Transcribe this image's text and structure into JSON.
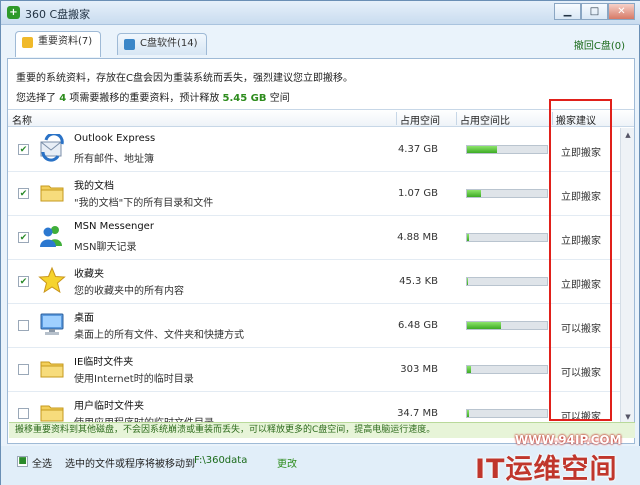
{
  "window": {
    "title": "360 C盘搬家",
    "app_icon": "360-logo-icon"
  },
  "tabs": [
    {
      "label": "重要资料(7)",
      "active": true,
      "icon": "folder-icon"
    },
    {
      "label": "C盘软件(14)",
      "active": false,
      "icon": "software-icon"
    }
  ],
  "restore_link": "撤回C盘(0)",
  "description": {
    "line1": "重要的系统资料，存放在C盘会因为重装系统而丢失，强烈建议您立即搬移。",
    "line2_prefix": "您选择了",
    "selected_count": "4",
    "line2_mid": "项需要搬移的重要资料，预计释放",
    "freed_size": "5.45 GB",
    "line2_suffix": "空间"
  },
  "columns": {
    "name": "名称",
    "size": "占用空间",
    "ratio": "占用空间比",
    "advice": "搬家建议"
  },
  "items": [
    {
      "name": "Outlook Express",
      "desc": "所有邮件、地址簿",
      "size": "4.37 GB",
      "ratio": 0.38,
      "advice": "立即搬家",
      "checked": true,
      "icon": "outlook-express-icon"
    },
    {
      "name": "我的文档",
      "desc": "\"我的文档\"下的所有目录和文件",
      "size": "1.07 GB",
      "ratio": 0.18,
      "advice": "立即搬家",
      "checked": true,
      "icon": "folder-icon"
    },
    {
      "name": "MSN Messenger",
      "desc": "MSN聊天记录",
      "size": "4.88 MB",
      "ratio": 0.02,
      "advice": "立即搬家",
      "checked": true,
      "icon": "msn-messenger-icon"
    },
    {
      "name": "收藏夹",
      "desc": "您的收藏夹中的所有内容",
      "size": "45.3 KB",
      "ratio": 0.01,
      "advice": "立即搬家",
      "checked": true,
      "icon": "star-icon"
    },
    {
      "name": "桌面",
      "desc": "桌面上的所有文件、文件夹和快捷方式",
      "size": "6.48 GB",
      "ratio": 0.43,
      "advice": "可以搬家",
      "checked": false,
      "icon": "desktop-computer-icon"
    },
    {
      "name": "IE临时文件夹",
      "desc": "使用Internet时的临时目录",
      "size": "303 MB",
      "ratio": 0.05,
      "advice": "可以搬家",
      "checked": false,
      "icon": "folder-icon"
    },
    {
      "name": "用户临时文件夹",
      "desc": "使用应用程序时的临时文件目录",
      "size": "34.7 MB",
      "ratio": 0.02,
      "advice": "可以搬家",
      "checked": false,
      "icon": "folder-icon"
    }
  ],
  "notice": "搬移重要资料到其他磁盘，不会因系统崩溃或重装而丢失，可以释放更多的C盘空间，提高电脑运行速度。",
  "footer": {
    "select_all": "全选",
    "move_text": "选中的文件或程序将被移动到",
    "target_path": "F:\\360data",
    "change": "更改"
  },
  "watermark": {
    "url": "WWW.94IP.COM",
    "text": "IT运维空间"
  },
  "colors": {
    "accent_green": "#2d8c1d",
    "highlight_red": "#e0201a",
    "progress_green": "#3cab24"
  }
}
